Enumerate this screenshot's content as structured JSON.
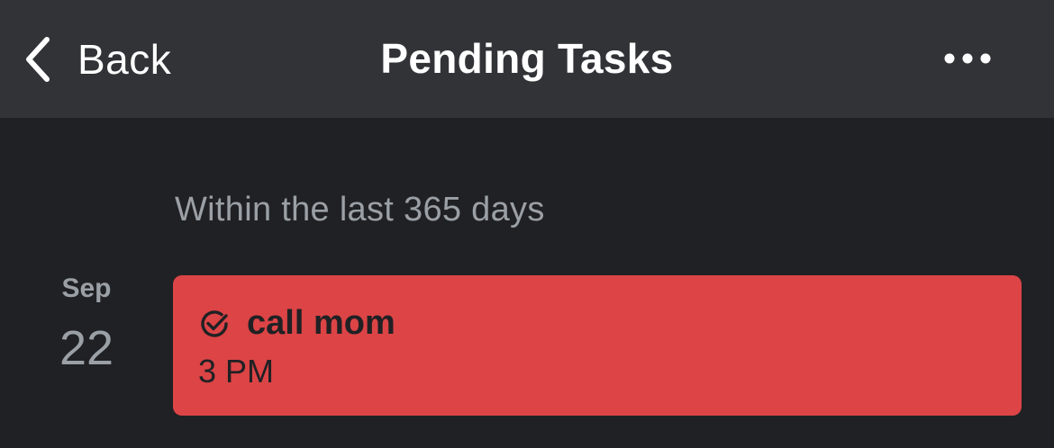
{
  "nav": {
    "back_label": "Back",
    "title": "Pending Tasks",
    "back_icon": "chevron-left-icon",
    "more_icon": "more-horizontal-icon"
  },
  "section": {
    "header": "Within the last 365 days"
  },
  "tasks": [
    {
      "month": "Sep",
      "day": "22",
      "title": "call mom",
      "time": "3 PM",
      "icon": "check-circle-icon",
      "color": "#dc4446"
    }
  ],
  "colors": {
    "background": "#202124",
    "nav_background": "#323337",
    "text_primary": "#ffffff",
    "text_secondary": "#9aa0a6",
    "task_accent": "#dc4446"
  }
}
